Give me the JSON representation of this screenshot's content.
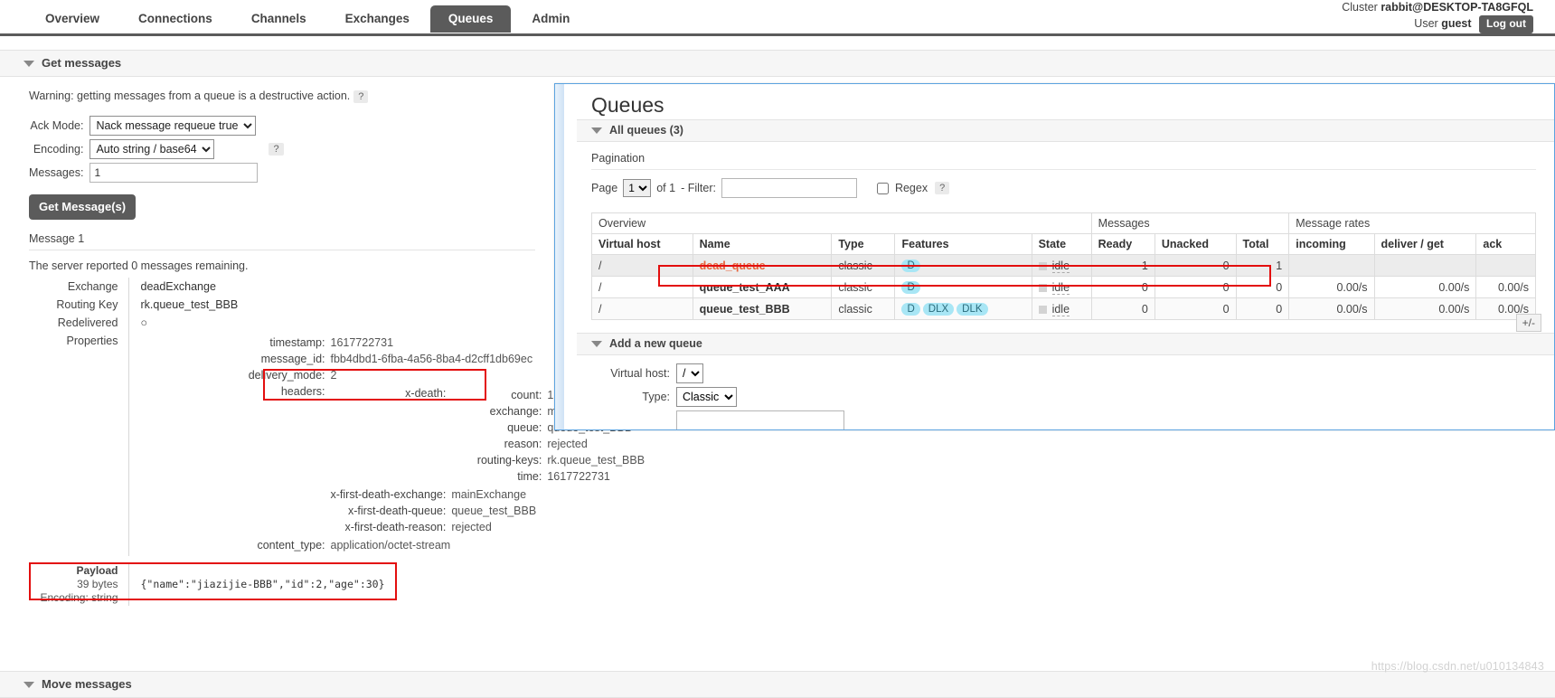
{
  "header": {
    "cluster_label": "Cluster",
    "cluster_name": "rabbit@DESKTOP-TA8GFQL",
    "user_label": "User",
    "user_name": "guest",
    "logout_label": "Log out"
  },
  "nav": {
    "items": [
      {
        "label": "Overview",
        "active": false
      },
      {
        "label": "Connections",
        "active": false
      },
      {
        "label": "Channels",
        "active": false
      },
      {
        "label": "Exchanges",
        "active": false
      },
      {
        "label": "Queues",
        "active": true
      },
      {
        "label": "Admin",
        "active": false
      }
    ]
  },
  "get_messages": {
    "section_title": "Get messages",
    "warning": "Warning: getting messages from a queue is a destructive action.",
    "help_glyph": "?",
    "ack_mode_label": "Ack Mode:",
    "ack_mode_value": "Nack message requeue true",
    "encoding_label": "Encoding:",
    "encoding_value": "Auto string / base64",
    "messages_label": "Messages:",
    "messages_value": "1",
    "get_button": "Get Message(s)"
  },
  "message": {
    "title": "Message 1",
    "remaining": "The server reported 0 messages remaining.",
    "exchange_label": "Exchange",
    "exchange_value": "deadExchange",
    "routing_key_label": "Routing Key",
    "routing_key_value": "rk.queue_test_BBB",
    "redelivered_label": "Redelivered",
    "redelivered_value": "○",
    "properties_label": "Properties",
    "properties": [
      {
        "key": "timestamp:",
        "value": "1617722731"
      },
      {
        "key": "message_id:",
        "value": "fbb4dbd1-6fba-4a56-8ba4-d2cff1db69ec"
      },
      {
        "key": "delivery_mode:",
        "value": "2"
      }
    ],
    "headers_label": "headers:",
    "x_death_label": "x-death:",
    "x_death": [
      {
        "key": "count:",
        "value": "1"
      },
      {
        "key": "exchange:",
        "value": "mainExchange"
      },
      {
        "key": "queue:",
        "value": "queue_test_BBB"
      },
      {
        "key": "reason:",
        "value": "rejected"
      },
      {
        "key": "routing-keys:",
        "value": "rk.queue_test_BBB"
      },
      {
        "key": "time:",
        "value": "1617722731"
      }
    ],
    "other_headers": [
      {
        "key": "x-first-death-exchange:",
        "value": "mainExchange"
      },
      {
        "key": "x-first-death-queue:",
        "value": "queue_test_BBB"
      },
      {
        "key": "x-first-death-reason:",
        "value": "rejected"
      }
    ],
    "content_type_label": "content_type:",
    "content_type_value": "application/octet-stream",
    "payload_label": "Payload",
    "payload_size": "39 bytes",
    "payload_encoding": "Encoding: string",
    "payload_value": "{\"name\":\"jiazijie-BBB\",\"id\":2,\"age\":30}"
  },
  "move_messages": {
    "section_title": "Move messages"
  },
  "queues_panel": {
    "title": "Queues",
    "all_queues_label": "All queues (3)",
    "pagination_label": "Pagination",
    "page_label": "Page",
    "page_value": "1",
    "of_label": "of 1",
    "filter_label": "- Filter:",
    "filter_value": "",
    "regex_label": "Regex",
    "regex_help": "?",
    "plus_minus": "+/-",
    "group_headers": [
      "Overview",
      "Messages",
      "Message rates"
    ],
    "columns": [
      "Virtual host",
      "Name",
      "Type",
      "Features",
      "State",
      "Ready",
      "Unacked",
      "Total",
      "incoming",
      "deliver / get",
      "ack"
    ],
    "rows": [
      {
        "vhost": "/",
        "name": "dead_queue",
        "highlight": true,
        "type": "classic",
        "features": [
          "D"
        ],
        "state": "idle",
        "ready": "1",
        "unacked": "0",
        "total": "1",
        "incoming": "",
        "deliver_get": "",
        "ack": ""
      },
      {
        "vhost": "/",
        "name": "queue_test_AAA",
        "highlight": false,
        "type": "classic",
        "features": [
          "D"
        ],
        "state": "idle",
        "ready": "0",
        "unacked": "0",
        "total": "0",
        "incoming": "0.00/s",
        "deliver_get": "0.00/s",
        "ack": "0.00/s"
      },
      {
        "vhost": "/",
        "name": "queue_test_BBB",
        "highlight": false,
        "type": "classic",
        "features": [
          "D",
          "DLX",
          "DLK"
        ],
        "state": "idle",
        "ready": "0",
        "unacked": "0",
        "total": "0",
        "incoming": "0.00/s",
        "deliver_get": "0.00/s",
        "ack": "0.00/s"
      }
    ],
    "add_queue": {
      "section_title": "Add a new queue",
      "vhost_label": "Virtual host:",
      "vhost_value": "/",
      "type_label": "Type:",
      "type_value": "Classic",
      "name_value": ""
    }
  },
  "watermark": "https://blog.csdn.net/u010134843",
  "colors": {
    "accent_dark": "#5b5b5b",
    "annotation_red": "#e30e0e",
    "dead_queue_orange": "#e8633a",
    "feature_badge": "#a8e6f5",
    "overlay_border": "#5ba3e0"
  }
}
